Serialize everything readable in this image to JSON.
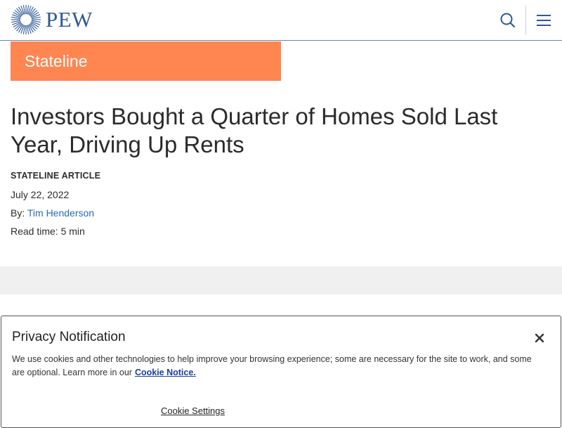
{
  "header": {
    "logo_text": "PEW",
    "search_icon": "search-icon",
    "menu_icon": "hamburger-menu-icon",
    "brand_color": "#2f5a93"
  },
  "section": {
    "label": "Stateline",
    "color": "#ff8551"
  },
  "article": {
    "title": "Investors Bought a Quarter of Homes Sold Last Year, Driving Up Rents",
    "kind": "STATELINE ARTICLE",
    "date": "July 22, 2022",
    "byline_prefix": "By:",
    "author": "Tim Henderson",
    "read_time": "Read time: 5 min"
  },
  "privacy": {
    "title": "Privacy Notification",
    "text": "We use cookies and other technologies to help improve your browsing experience; some are necessary for the site to work, and some are optional. Learn more in our",
    "link_label": "Cookie Notice.",
    "settings_label": "Cookie Settings",
    "close_icon": "close-icon"
  }
}
